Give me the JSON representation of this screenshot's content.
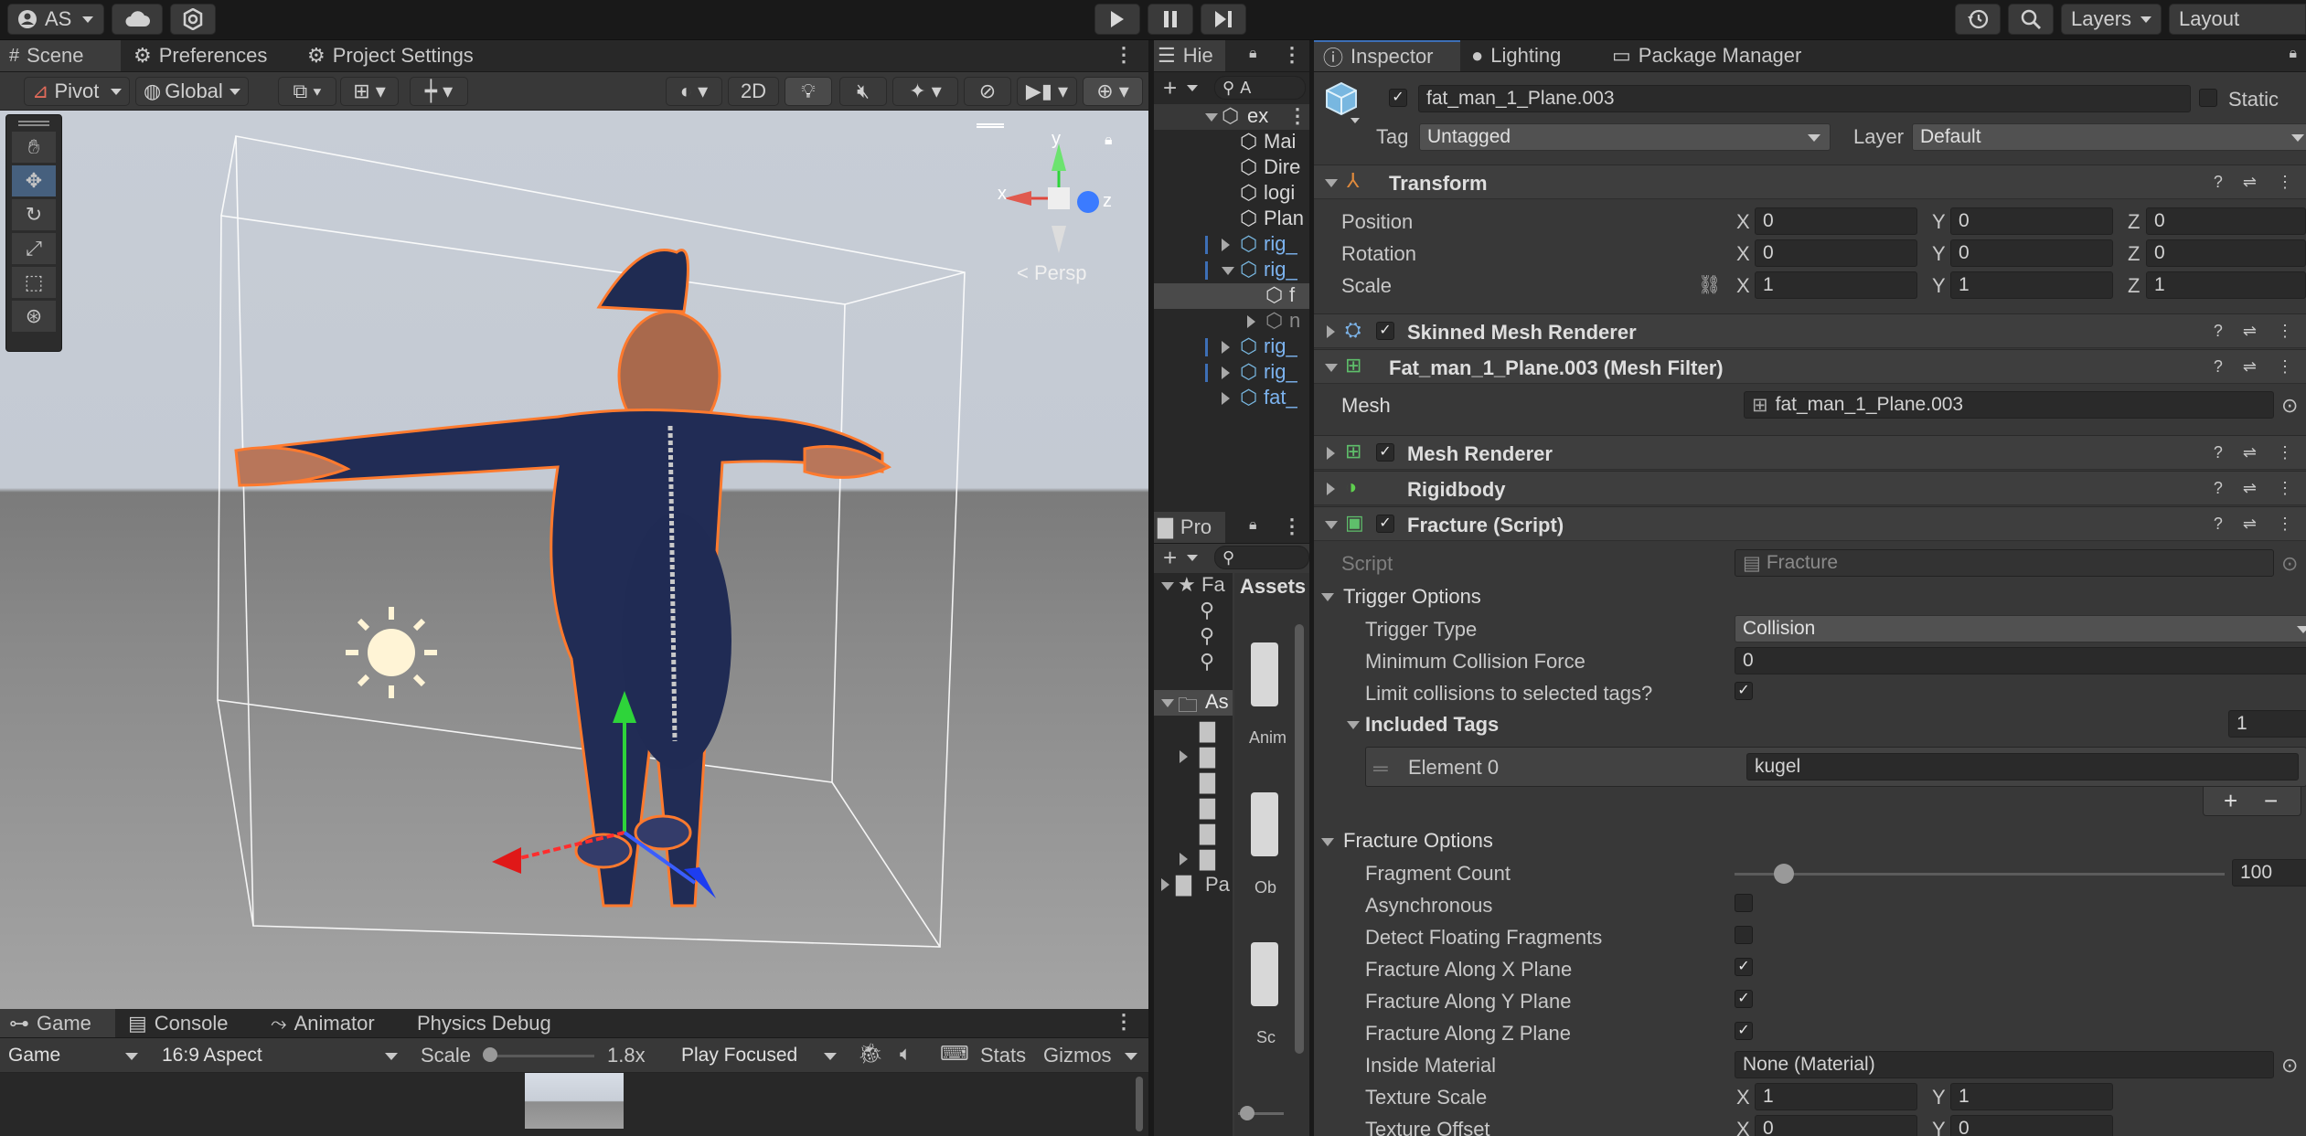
{
  "toolbar": {
    "account": "AS",
    "layers": "Layers",
    "layout": "Layout"
  },
  "scene_tabs": {
    "scene": "Scene",
    "preferences": "Preferences",
    "project_settings": "Project Settings"
  },
  "scene_toolbar": {
    "pivot": "Pivot",
    "global": "Global",
    "mode_2d": "2D"
  },
  "gizmo": {
    "x": "x",
    "y": "y",
    "z": "z",
    "persp": "Persp"
  },
  "game_tabs": {
    "game": "Game",
    "console": "Console",
    "animator": "Animator",
    "physics_debug": "Physics Debug"
  },
  "game_toolbar": {
    "display": "Game",
    "aspect": "16:9 Aspect",
    "scale_label": "Scale",
    "scale_value": "1.8x",
    "scale_fraction": 0.05,
    "play_mode": "Play Focused",
    "stats": "Stats",
    "gizmos": "Gizmos"
  },
  "hierarchy": {
    "tab": "Hie",
    "search_placeholder": "A",
    "root": "ex",
    "items": [
      "Mai",
      "Dire",
      "logi",
      "Plan",
      "rig_",
      "rig_",
      "f",
      "n",
      "rig_",
      "rig_",
      "fat_"
    ]
  },
  "project": {
    "tab": "Pro",
    "favorites": "Fa",
    "assets_root": "As",
    "packages": "Pa",
    "assets_header": "Assets",
    "asset_labels": [
      "Anim",
      "Ob",
      "Sc"
    ]
  },
  "inspector_tabs": {
    "inspector": "Inspector",
    "lighting": "Lighting",
    "package_manager": "Package Manager"
  },
  "inspector": {
    "object_name": "fat_man_1_Plane.003",
    "static_label": "Static",
    "tag_label": "Tag",
    "tag_value": "Untagged",
    "layer_label": "Layer",
    "layer_value": "Default",
    "transform": {
      "title": "Transform",
      "position_label": "Position",
      "rotation_label": "Rotation",
      "scale_label": "Scale",
      "axis_x": "X",
      "axis_y": "Y",
      "axis_z": "Z",
      "position": [
        "0",
        "0",
        "0"
      ],
      "rotation": [
        "0",
        "0",
        "0"
      ],
      "scale": [
        "1",
        "1",
        "1"
      ]
    },
    "skinned_mesh_renderer": "Skinned Mesh Renderer",
    "mesh_filter": {
      "title": "Fat_man_1_Plane.003 (Mesh Filter)",
      "mesh_label": "Mesh",
      "mesh_value": "fat_man_1_Plane.003"
    },
    "mesh_renderer": "Mesh Renderer",
    "rigidbody": "Rigidbody",
    "fracture": {
      "title": "Fracture (Script)",
      "script_label": "Script",
      "script_value": "Fracture",
      "trigger_options": "Trigger Options",
      "trigger_type_label": "Trigger Type",
      "trigger_type_value": "Collision",
      "min_force_label": "Minimum Collision Force",
      "min_force_value": "0",
      "limit_label": "Limit collisions to selected tags?",
      "included_tags_label": "Included Tags",
      "included_tags_count": "1",
      "element0_label": "Element 0",
      "element0_value": "kugel",
      "add_symbol": "+",
      "remove_symbol": "−",
      "fracture_options": "Fracture Options",
      "fragment_count_label": "Fragment Count",
      "fragment_count_value": "100",
      "fragment_count_fraction": 0.1,
      "asynchronous_label": "Asynchronous",
      "detect_floating_label": "Detect Floating Fragments",
      "along_x_label": "Fracture Along X Plane",
      "along_y_label": "Fracture Along Y Plane",
      "along_z_label": "Fracture Along Z Plane",
      "inside_material_label": "Inside Material",
      "inside_material_value": "None (Material)",
      "texture_scale_label": "Texture Scale",
      "texture_scale": [
        "1",
        "1"
      ],
      "texture_offset_label": "Texture Offset",
      "texture_offset": [
        "0",
        "0"
      ]
    }
  },
  "colors": {
    "accent_blue": "#3d6fb6",
    "panel_bg": "#383838",
    "header_bg": "#282828",
    "field_bg": "#2a2a2a",
    "checkmark": "#e8e8e8"
  }
}
